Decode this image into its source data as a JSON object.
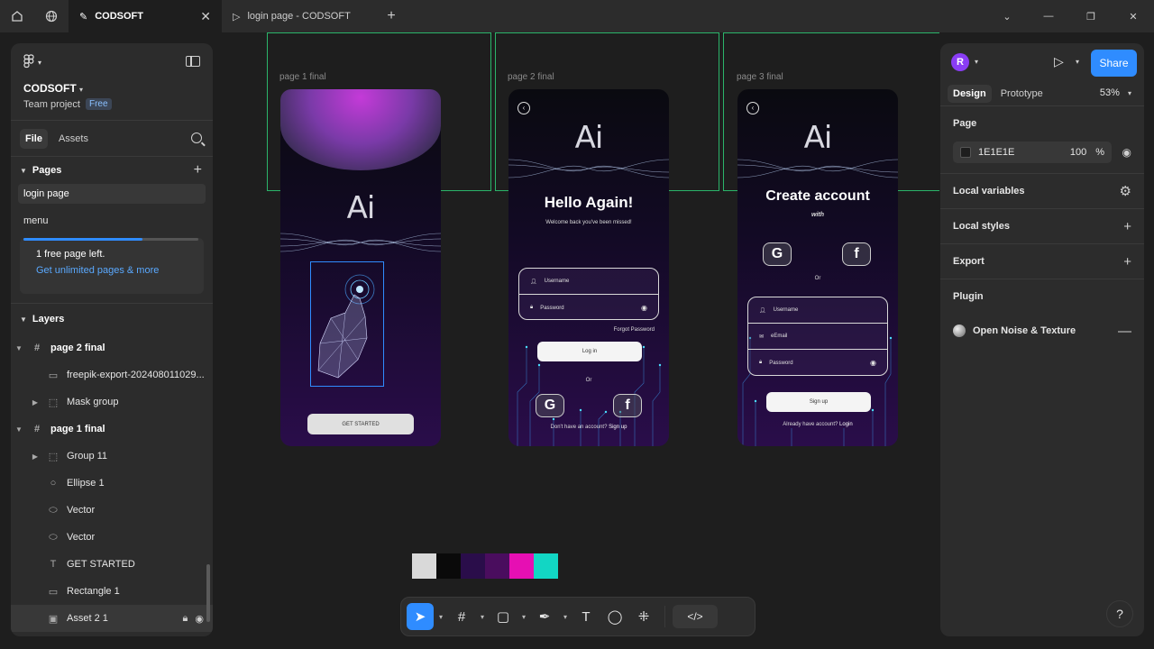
{
  "titlebar": {
    "tabs": [
      {
        "label": "CODSOFT",
        "active": true
      },
      {
        "label": "login page - CODSOFT",
        "active": false
      }
    ]
  },
  "left_panel": {
    "project_name": "CODSOFT",
    "project_type": "Team project",
    "plan_badge": "Free",
    "tabs": [
      "File",
      "Assets"
    ],
    "pages_title": "Pages",
    "pages": [
      {
        "label": "login page",
        "selected": true
      },
      {
        "label": "menu",
        "selected": false
      }
    ],
    "upgrade": {
      "line1": "1 free page left.",
      "line2": "Get unlimited pages & more",
      "progress": 0.68
    },
    "layers_title": "Layers",
    "layers": [
      {
        "label": "page 2 final",
        "type": "frame"
      },
      {
        "label": "freepik-export-202408011029...",
        "type": "image"
      },
      {
        "label": "Mask group",
        "type": "group"
      },
      {
        "label": "page 1 final",
        "type": "frame"
      },
      {
        "label": "Group 11",
        "type": "group"
      },
      {
        "label": "Ellipse 1",
        "type": "ellipse"
      },
      {
        "label": "Vector",
        "type": "vector"
      },
      {
        "label": "Vector",
        "type": "vector"
      },
      {
        "label": "GET STARTED",
        "type": "text"
      },
      {
        "label": "Rectangle 1",
        "type": "rect"
      },
      {
        "label": "Asset 2 1",
        "type": "image"
      }
    ]
  },
  "canvas": {
    "frames": [
      {
        "label": "page 1 final"
      },
      {
        "label": "page 2 final"
      },
      {
        "label": "page 3 final"
      }
    ],
    "page1": {
      "logo": "Ai",
      "button": "GET STARTED"
    },
    "page2": {
      "logo": "Ai",
      "title": "Hello Again!",
      "subtitle": "Welcome back you've been missed!",
      "username": "Username",
      "password": "Password",
      "forgot": "Forgot Password",
      "login": "Log in",
      "or": "Or",
      "footer": "Don't have an account?",
      "footer_link": "Sign up"
    },
    "page3": {
      "logo": "Ai",
      "title": "Create account",
      "subtitle": "with",
      "or": "Or",
      "username": "Username",
      "email": "eEmail",
      "password": "Password",
      "signup": "Sign up",
      "footer": "Already have account?",
      "footer_link": "Login"
    },
    "swatches": [
      "#d9d9d9",
      "#0a0a0a",
      "#2a0d4a",
      "#4a0d5e",
      "#e60fb3",
      "#12d6c4"
    ]
  },
  "right_panel": {
    "avatar_initial": "R",
    "share": "Share",
    "tabs": [
      "Design",
      "Prototype"
    ],
    "zoom": "53%",
    "page_title": "Page",
    "page_color": "1E1E1E",
    "page_opacity": "100",
    "percent": "%",
    "sections": [
      "Local variables",
      "Local styles",
      "Export"
    ],
    "plugin_title": "Plugin",
    "plugin_item": "Open Noise & Texture"
  },
  "help": "?"
}
